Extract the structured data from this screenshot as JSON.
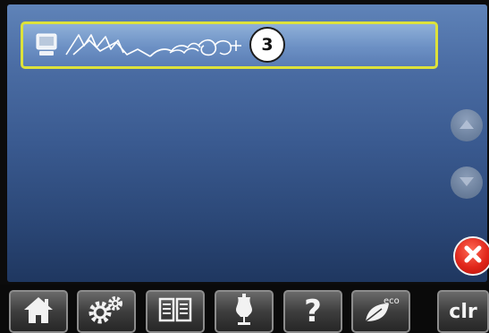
{
  "selected_slot": {
    "memory_icon": "memory-file-icon",
    "stitch_preview_icon": "stitch-sequence-icon",
    "stitch_count": "3",
    "highlight_color": "#dde23a"
  },
  "scroll": {
    "up_icon": "chevron-up-icon",
    "down_icon": "chevron-down-icon"
  },
  "close": {
    "icon": "close-icon",
    "color": "#e0261a"
  },
  "toolbar": {
    "home_icon": "home-icon",
    "settings_icon": "gears-icon",
    "tutorial_icon": "book-icon",
    "consultant_icon": "dress-form-icon",
    "help_label": "?",
    "eco_icon": "eco-leaf-icon",
    "eco_label": "eco",
    "clr_label": "clr"
  }
}
